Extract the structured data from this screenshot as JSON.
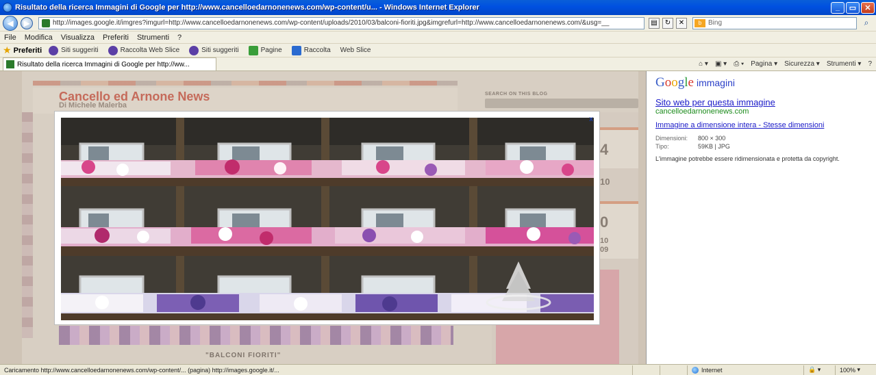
{
  "window": {
    "title": "Risultato della ricerca Immagini di Google per http://www.cancelloedarnonenews.com/wp-content/u... - Windows Internet Explorer",
    "min_label": "_",
    "max_label": "▭",
    "close_label": "✕"
  },
  "address": {
    "url": "http://images.google.it/imgres?imgurl=http://www.cancelloedarnonenews.com/wp-content/uploads/2010/03/balconi-fioriti.jpg&imgrefurl=http://www.cancelloedarnonenews.com/&usg=__",
    "search_placeholder": "Bing",
    "search_provider": "b"
  },
  "menu": [
    "File",
    "Modifica",
    "Visualizza",
    "Preferiti",
    "Strumenti",
    "?"
  ],
  "favorites": {
    "label": "Preferiti",
    "items": [
      "Siti suggeriti",
      "Raccolta Web Slice",
      "Siti suggeriti",
      "Pagine",
      "Raccolta",
      "Web Slice"
    ]
  },
  "tab": {
    "label": "Risultato della ricerca Immagini di Google per http://ww..."
  },
  "commandbar": [
    "Pagina ▾",
    "Sicurezza ▾",
    "Strumenti ▾",
    "?"
  ],
  "blog": {
    "title": "Cancello ed Arnone News",
    "subtitle": "Di Michele Malerba",
    "search_label": "SEARCH ON THIS BLOG",
    "numbers": [
      "4",
      "10",
      "0",
      "10",
      "09"
    ],
    "caption": "\"BALCONI FIORITI\""
  },
  "lightbox": {
    "close_label": "x"
  },
  "google": {
    "logo_letters": [
      "G",
      "o",
      "o",
      "g",
      "l",
      "e"
    ],
    "logo_suffix": "immagini",
    "site_link": "Sito web per questa immagine",
    "domain": "cancelloedarnonenews.com",
    "full_image_link": "Immagine a dimensione intera - Stesse dimensioni",
    "meta": [
      {
        "key": "Dimensioni:",
        "value": "800 × 300"
      },
      {
        "key": "Tipo:",
        "value": "59KB | JPG"
      }
    ],
    "note": "L'immagine potrebbe essere ridimensionata e protetta da copyright."
  },
  "status": {
    "text": "Caricamento http://www.cancelloedarnonenews.com/wp-content/... (pagina) http://images.google.it/...",
    "zone": "Internet",
    "zoom": "100%"
  }
}
